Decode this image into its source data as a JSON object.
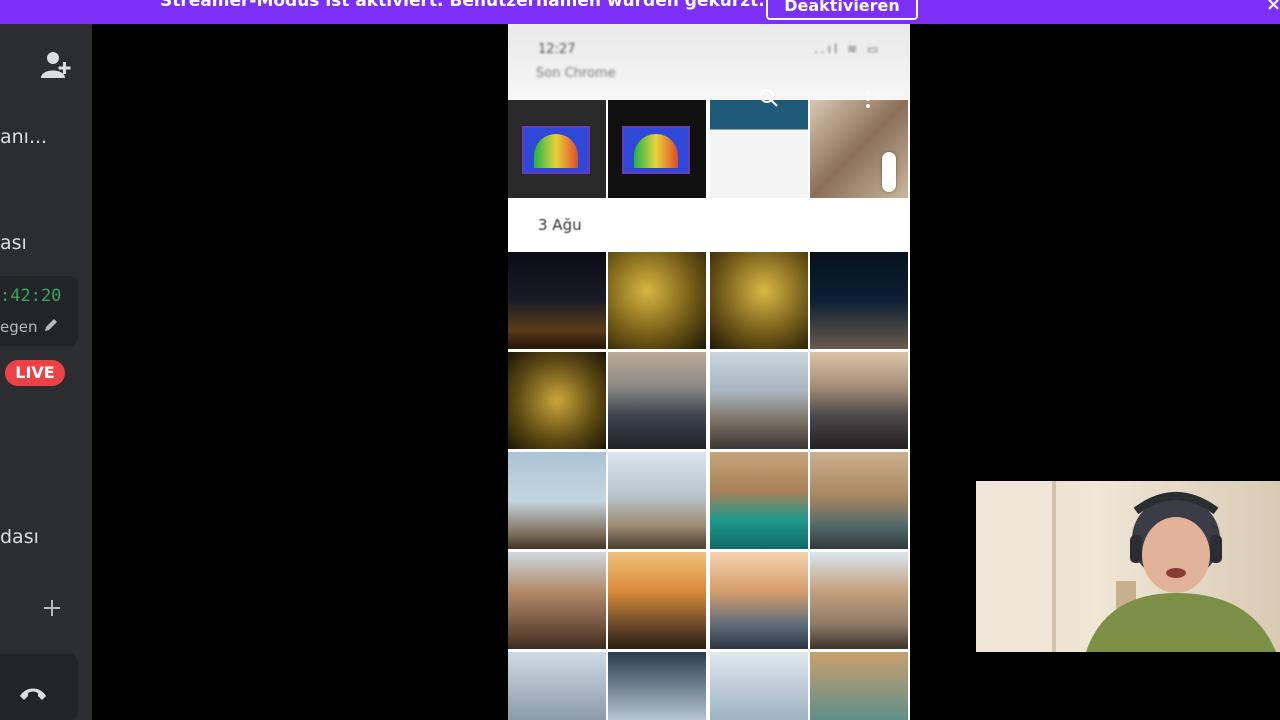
{
  "banner": {
    "text": "Streamer-Modus ist aktiviert. Benutzernamen wurden gekürzt.",
    "button_label": "Deaktivieren",
    "close_symbol": "×"
  },
  "sidebar": {
    "items": [
      {
        "label": "anı..."
      },
      {
        "label": "ası"
      },
      {
        "label": "dası"
      }
    ],
    "timer": ":42:20",
    "timer_sub": "egen",
    "live_label": "LIVE",
    "plus_symbol": "+"
  },
  "phone": {
    "status_time": "12:27",
    "status_apps": "Son   Chrome",
    "status_icons": "..ıl ≋ ▭",
    "date_label": "3 Ağu"
  },
  "colors": {
    "banner": "#7b2ff7",
    "sidebar": "#2b2d31",
    "timer_green": "#3ba55c",
    "live_red": "#ed4245"
  }
}
